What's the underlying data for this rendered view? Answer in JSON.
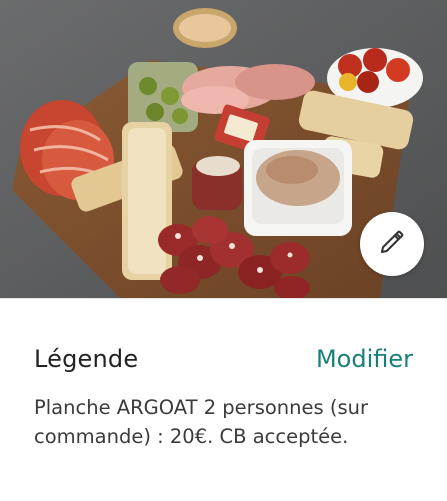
{
  "photo": {
    "subject": "charcuterie-board-photo"
  },
  "edit_button": {
    "icon": "pencil-icon"
  },
  "caption": {
    "title": "Légende",
    "action_label": "Modifier",
    "text": "Planche ARGOAT 2 personnes (sur commande) : 20€. CB acceptée."
  },
  "colors": {
    "accent": "#1a7f79",
    "title_text": "#222222",
    "body_text": "#3b3b3b"
  }
}
